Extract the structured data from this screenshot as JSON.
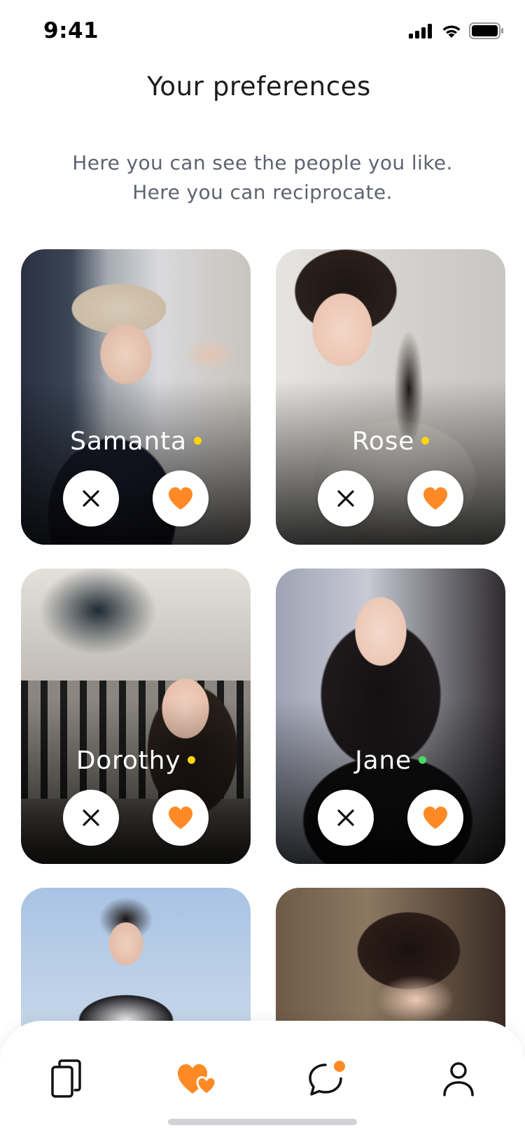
{
  "status_bar": {
    "time": "9:41",
    "icons": [
      "cellular-signal-icon",
      "wifi-icon",
      "battery-icon"
    ]
  },
  "header": {
    "title": "Your preferences",
    "subtitle_lines": [
      "Here you can see the people you like.",
      "Here you can reciprocate."
    ]
  },
  "profiles": [
    {
      "name": "Samanta",
      "status_color": "#FFD60A"
    },
    {
      "name": "Rose",
      "status_color": "#FFD60A"
    },
    {
      "name": "Dorothy",
      "status_color": "#FFD60A"
    },
    {
      "name": "Jane",
      "status_color": "#4CD964"
    },
    {
      "name": "",
      "status_color": ""
    },
    {
      "name": "",
      "status_color": ""
    }
  ],
  "actions": {
    "dislike_icon": "close-icon",
    "like_icon": "heart-icon"
  },
  "bottom_nav": {
    "items": [
      {
        "icon": "cards-icon",
        "active": false
      },
      {
        "icon": "hearts-icon",
        "active": true
      },
      {
        "icon": "chat-icon",
        "active": false,
        "badge": true
      },
      {
        "icon": "profile-icon",
        "active": false
      }
    ]
  },
  "colors": {
    "accent": "#FF8A25",
    "text_primary": "#1B1B1B",
    "text_secondary": "#5E6370",
    "online": "#4CD964",
    "away": "#FFD60A"
  }
}
